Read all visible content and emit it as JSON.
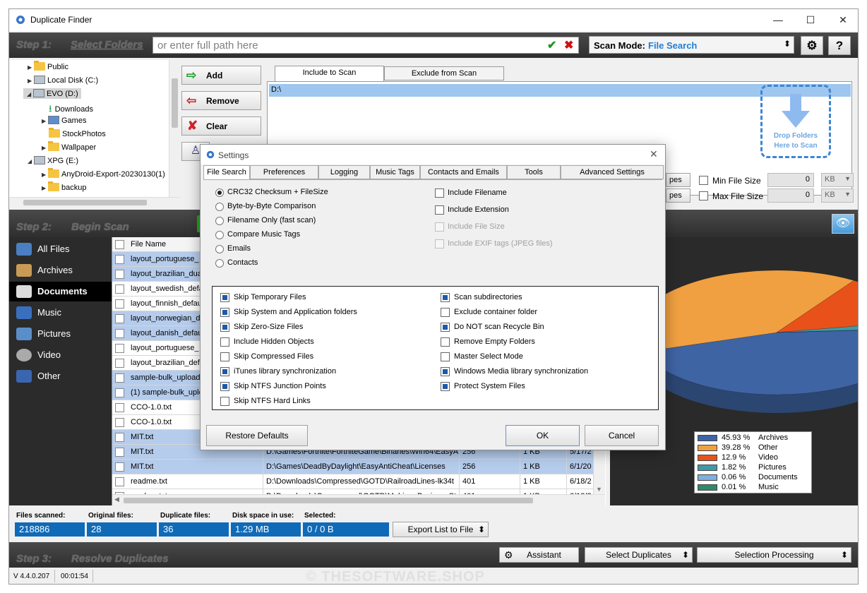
{
  "window": {
    "title": "Duplicate Finder"
  },
  "step1": {
    "label": "Step 1:",
    "select_folders": "Select Folders",
    "path_placeholder": "or enter full path here",
    "scan_mode_label": "Scan Mode:",
    "scan_mode_value": "File Search"
  },
  "tree": [
    {
      "label": "Public",
      "type": "folder"
    },
    {
      "label": "Local Disk (C:)",
      "type": "drive"
    },
    {
      "label": "EVO (D:)",
      "type": "drive"
    },
    {
      "label": "Downloads",
      "type": "download"
    },
    {
      "label": "Games",
      "type": "folder"
    },
    {
      "label": "StockPhotos",
      "type": "folder"
    },
    {
      "label": "Wallpaper",
      "type": "folder"
    },
    {
      "label": "XPG (E:)",
      "type": "drive"
    },
    {
      "label": "AnyDroid-Export-20230130(1)",
      "type": "folder"
    },
    {
      "label": "backup",
      "type": "folder"
    }
  ],
  "folder_buttons": {
    "add": "Add",
    "remove": "Remove",
    "clear": "Clear"
  },
  "scan_tabs": {
    "include": "Include to Scan",
    "exclude": "Exclude from Scan"
  },
  "include_list": [
    "D:\\"
  ],
  "drop_zone": "Drop Folders Here to Scan",
  "size_filters": {
    "min_label": "Min File Size",
    "max_label": "Max File Size",
    "min_value": "0",
    "max_value": "0",
    "min_unit": "KB",
    "max_unit": "KB",
    "types_fragment_1": "pes",
    "types_fragment_2": "pes"
  },
  "step2": {
    "label": "Step 2:",
    "begin_scan": "Begin Scan"
  },
  "categories": [
    {
      "label": "All Files",
      "icon": "all-files-icon",
      "color": "#4a7fc2"
    },
    {
      "label": "Archives",
      "icon": "archive-icon",
      "color": "#c89a55"
    },
    {
      "label": "Documents",
      "icon": "document-icon",
      "color": "#dcdcdc"
    },
    {
      "label": "Music",
      "icon": "music-icon",
      "color": "#3a6fc0"
    },
    {
      "label": "Pictures",
      "icon": "picture-icon",
      "color": "#5a8ec8"
    },
    {
      "label": "Video",
      "icon": "video-icon",
      "color": "#aaaaaa"
    },
    {
      "label": "Other",
      "icon": "other-icon",
      "color": "#3a66b0"
    }
  ],
  "grid": {
    "header": "File Name",
    "rows": [
      {
        "name": "layout_portuguese_",
        "path": "",
        "size": "",
        "disk": "",
        "date": "",
        "sel": true
      },
      {
        "name": "layout_brazilian_dua",
        "path": "",
        "size": "",
        "disk": "",
        "date": "",
        "sel": true
      },
      {
        "name": "layout_swedish_defa",
        "path": "",
        "size": "",
        "disk": "",
        "date": "",
        "sel": false
      },
      {
        "name": "layout_finnish_defau",
        "path": "",
        "size": "",
        "disk": "",
        "date": "",
        "sel": false
      },
      {
        "name": "layout_norwegian_d",
        "path": "",
        "size": "",
        "disk": "",
        "date": "",
        "sel": true
      },
      {
        "name": "layout_danish_defau",
        "path": "",
        "size": "",
        "disk": "",
        "date": "",
        "sel": true
      },
      {
        "name": "layout_portuguese_",
        "path": "",
        "size": "",
        "disk": "",
        "date": "",
        "sel": false
      },
      {
        "name": "layout_brazilian_def",
        "path": "",
        "size": "",
        "disk": "",
        "date": "",
        "sel": false
      },
      {
        "name": "sample-bulk_upload",
        "path": "",
        "size": "",
        "disk": "",
        "date": "",
        "sel": true
      },
      {
        "name": "(1) sample-bulk_uplo",
        "path": "",
        "size": "",
        "disk": "",
        "date": "",
        "sel": true
      },
      {
        "name": "CCO-1.0.txt",
        "path": "",
        "size": "",
        "disk": "",
        "date": "",
        "sel": false
      },
      {
        "name": "CCO-1.0.txt",
        "path": "",
        "size": "",
        "disk": "",
        "date": "",
        "sel": false
      },
      {
        "name": "MIT.txt",
        "path": "",
        "size": "",
        "disk": "",
        "date": "",
        "sel": true
      },
      {
        "name": "MIT.txt",
        "path": "D:\\Games\\Fortnite\\FortniteGame\\Binaries\\Win64\\EasyA",
        "size": "256",
        "disk": "1 KB",
        "date": "5/17/2",
        "sel": true
      },
      {
        "name": "MIT.txt",
        "path": "D:\\Games\\DeadByDaylight\\EasyAntiCheat\\Licenses",
        "size": "256",
        "disk": "1 KB",
        "date": "6/1/20",
        "sel": true
      },
      {
        "name": "readme.txt",
        "path": "D:\\Downloads\\Compressed\\GOTD\\RailroadLines-lk34t",
        "size": "401",
        "disk": "1 KB",
        "date": "6/18/2",
        "sel": false
      },
      {
        "name": "readme.txt",
        "path": "D:\\Downloads\\Compressed\\GOTD\\MahjongBusinessSt",
        "size": "401",
        "disk": "1 KB",
        "date": "6/18/2",
        "sel": false
      }
    ]
  },
  "chart_data": {
    "type": "pie",
    "categories": [
      "Archives",
      "Other",
      "Video",
      "Pictures",
      "Documents",
      "Music"
    ],
    "values": [
      45.93,
      39.28,
      12.9,
      1.82,
      0.06,
      0.01
    ],
    "labels": [
      "45.93 %",
      "39.28 %",
      "12.9 %",
      "1.82 %",
      "0.06 %",
      "0.01 %"
    ],
    "colors": [
      "#3f64a4",
      "#f0a040",
      "#e8521a",
      "#3f9aa8",
      "#7fb0e0",
      "#2e8a6a"
    ],
    "legend_position": "bottom-right"
  },
  "stats": {
    "files_scanned_label": "Files scanned:",
    "files_scanned": "218886",
    "original_label": "Original files:",
    "original": "28",
    "duplicate_label": "Duplicate files:",
    "duplicate": "36",
    "disk_label": "Disk space in use:",
    "disk": "1.29 MB",
    "selected_label": "Selected:",
    "selected": "0 / 0 B",
    "export": "Export List to File"
  },
  "step3": {
    "label": "Step 3:",
    "resolve": "Resolve Duplicates",
    "assistant": "Assistant",
    "select_duplicates": "Select Duplicates",
    "selection_processing": "Selection Processing"
  },
  "status": {
    "version": "V 4.4.0.207",
    "time": "00:01:54",
    "watermark": "© THESOFTWARE.SHOP"
  },
  "dialog": {
    "title": "Settings",
    "tabs": [
      "File Search",
      "Preferences",
      "Logging",
      "Music Tags",
      "Contacts and Emails",
      "Tools",
      "Advanced Settings"
    ],
    "radios": [
      {
        "label": "CRC32 Checksum + FileSize",
        "on": true
      },
      {
        "label": "Byte-by-Byte Comparison",
        "on": false
      },
      {
        "label": "Filename Only (fast scan)",
        "on": false
      },
      {
        "label": "Compare Music Tags",
        "on": false
      },
      {
        "label": "Emails",
        "on": false
      },
      {
        "label": "Contacts",
        "on": false
      }
    ],
    "include_opts": [
      {
        "label": "Include Filename",
        "on": false,
        "disabled": false
      },
      {
        "label": "Include Extension",
        "on": false,
        "disabled": false
      },
      {
        "label": "Include File Size",
        "on": false,
        "disabled": true
      },
      {
        "label": "Include EXIF tags (JPEG files)",
        "on": false,
        "disabled": true
      }
    ],
    "left_opts": [
      {
        "label": "Skip Temporary Files",
        "on": true
      },
      {
        "label": "Skip System and Application folders",
        "on": true
      },
      {
        "label": "Skip Zero-Size Files",
        "on": true
      },
      {
        "label": "Include Hidden Objects",
        "on": false
      },
      {
        "label": "Skip Compressed Files",
        "on": false
      },
      {
        "label": "iTunes library synchronization",
        "on": true
      },
      {
        "label": "Skip NTFS Junction Points",
        "on": true
      },
      {
        "label": "Skip NTFS Hard Links",
        "on": false
      }
    ],
    "right_opts": [
      {
        "label": "Scan subdirectories",
        "on": true
      },
      {
        "label": "Exclude container folder",
        "on": false
      },
      {
        "label": "Do NOT scan Recycle Bin",
        "on": true
      },
      {
        "label": "Remove Empty Folders",
        "on": false
      },
      {
        "label": "Master Select Mode",
        "on": false
      },
      {
        "label": "Windows Media library synchronization",
        "on": true
      },
      {
        "label": "Protect System Files",
        "on": true
      }
    ],
    "restore": "Restore Defaults",
    "ok": "OK",
    "cancel": "Cancel"
  }
}
